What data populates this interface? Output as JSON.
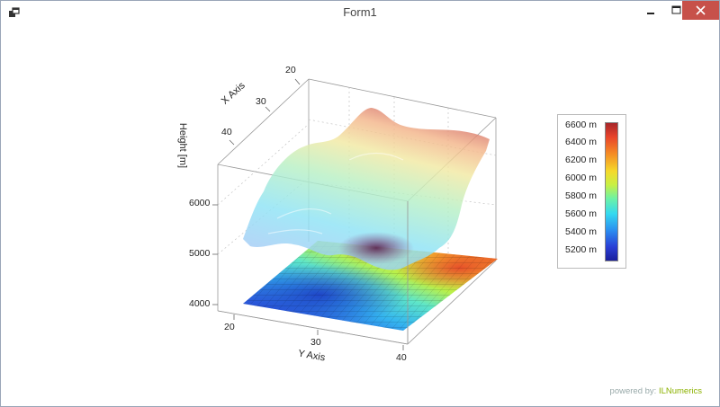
{
  "window": {
    "title": "Form1"
  },
  "axes": {
    "x_title": "X Axis",
    "y_title": "Y Axis",
    "z_title": "Height [m]",
    "x_ticks": [
      "20",
      "30",
      "40"
    ],
    "y_ticks": [
      "20",
      "30",
      "40"
    ],
    "z_ticks": [
      "4000",
      "5000",
      "6000"
    ]
  },
  "legend": {
    "labels": [
      "6600 m",
      "6400 m",
      "6200 m",
      "6000 m",
      "5800 m",
      "5600 m",
      "5400 m",
      "5200 m"
    ]
  },
  "footer": {
    "powered_prefix": "powered by:",
    "brand": "ILNumerics"
  },
  "colors": {
    "close_button": "#c7514a",
    "brand": "#8cb200"
  },
  "chart_data": {
    "type": "surface",
    "x_range": [
      20,
      45
    ],
    "y_range": [
      20,
      42
    ],
    "z_range": [
      4000,
      6600
    ],
    "colormap_range": [
      5200,
      6600
    ],
    "has_floor_contour_projection": true
  }
}
